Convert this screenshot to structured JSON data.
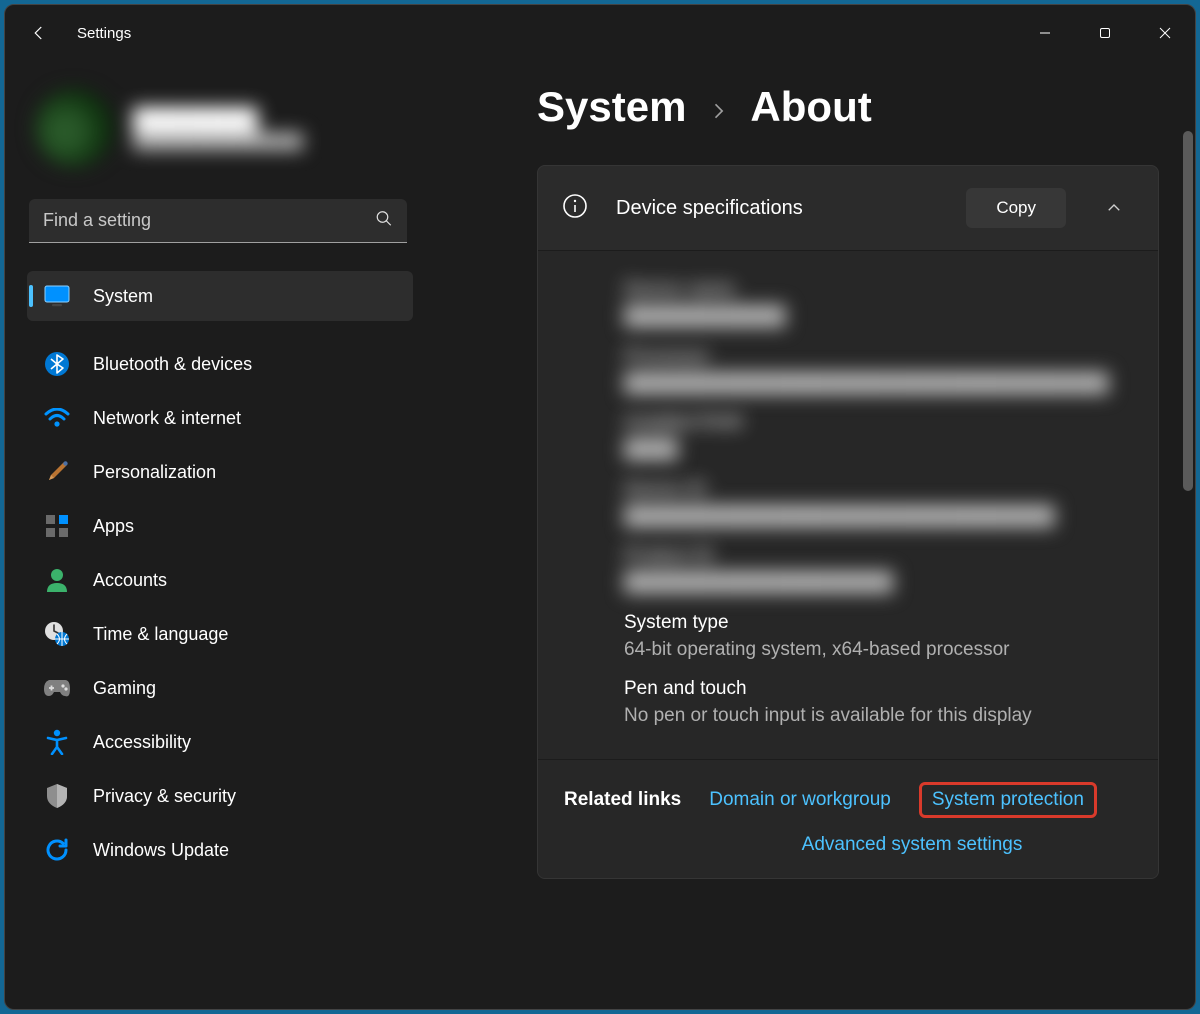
{
  "titlebar": {
    "title": "Settings"
  },
  "profile": {
    "name": "████████",
    "email": "████████████████"
  },
  "search": {
    "placeholder": "Find a setting"
  },
  "nav": {
    "items": [
      {
        "label": "System"
      },
      {
        "label": "Bluetooth & devices"
      },
      {
        "label": "Network & internet"
      },
      {
        "label": "Personalization"
      },
      {
        "label": "Apps"
      },
      {
        "label": "Accounts"
      },
      {
        "label": "Time & language"
      },
      {
        "label": "Gaming"
      },
      {
        "label": "Accessibility"
      },
      {
        "label": "Privacy & security"
      },
      {
        "label": "Windows Update"
      }
    ]
  },
  "breadcrumb": {
    "parent": "System",
    "current": "About"
  },
  "device_specs": {
    "header_title": "Device specifications",
    "copy_label": "Copy",
    "rows": [
      {
        "label": "Device name",
        "value": "████████████"
      },
      {
        "label": "Processor",
        "value": "████████████████████████████████████"
      },
      {
        "label": "Installed RAM",
        "value": "████"
      },
      {
        "label": "Device ID",
        "value": "████████████████████████████████"
      },
      {
        "label": "Product ID",
        "value": "████████████████████"
      },
      {
        "label": "System type",
        "value": "64-bit operating system, x64-based processor"
      },
      {
        "label": "Pen and touch",
        "value": "No pen or touch input is available for this display"
      }
    ]
  },
  "related": {
    "label": "Related links",
    "links": [
      {
        "text": "Domain or workgroup"
      },
      {
        "text": "System protection"
      },
      {
        "text": "Advanced system settings"
      }
    ]
  }
}
